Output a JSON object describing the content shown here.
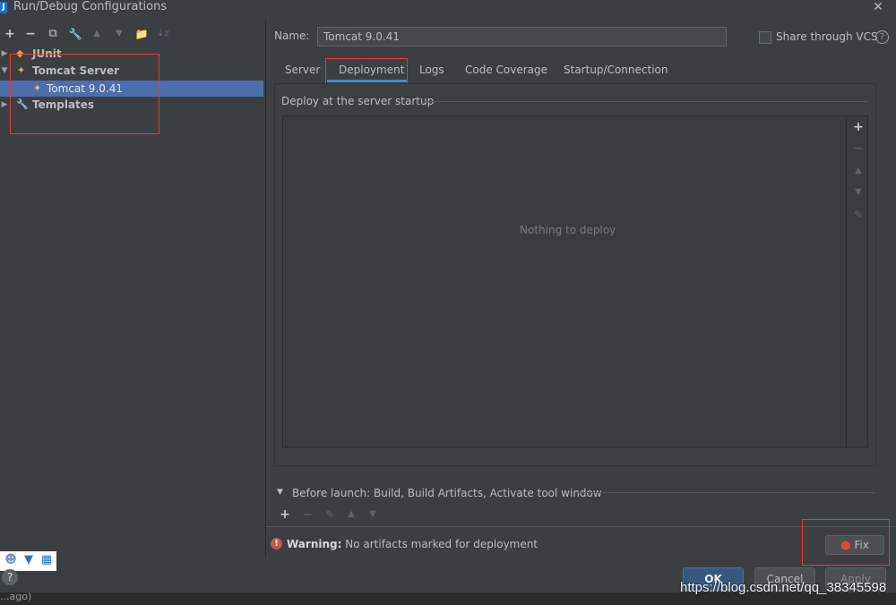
{
  "window": {
    "title": "Run/Debug Configurations",
    "app_icon": "J"
  },
  "toolbar": {
    "add": "+",
    "remove": "−",
    "copy": "⧉",
    "edit": "🔧",
    "up": "▲",
    "down": "▼",
    "folder": "📁",
    "sort": "↓z"
  },
  "tree": {
    "items": [
      {
        "label": "JUnit"
      },
      {
        "label": "Tomcat Server"
      },
      {
        "label": "Tomcat 9.0.41"
      },
      {
        "label": "Templates"
      }
    ]
  },
  "form": {
    "name_label": "Name:",
    "name_value": "Tomcat 9.0.41",
    "share_label": "Share through VCS",
    "help": "?"
  },
  "tabs": [
    {
      "label": "Server"
    },
    {
      "label": "Deployment"
    },
    {
      "label": "Logs"
    },
    {
      "label": "Code Coverage"
    },
    {
      "label": "Startup/Connection"
    }
  ],
  "deployment": {
    "section_title": "Deploy at the server startup",
    "empty_text": "Nothing to deploy"
  },
  "before_launch": {
    "label": "Before launch: Build, Build Artifacts, Activate tool window"
  },
  "warning": {
    "title": "Warning:",
    "message": " No artifacts marked for deployment",
    "fix_label": "Fix"
  },
  "buttons": {
    "ok": "OK",
    "cancel": "Cancel",
    "apply": "Apply"
  },
  "bottom": {
    "partial_text": "...ago)",
    "watermark": "https://blog.csdn.net/qq_38345598"
  },
  "colors": {
    "accent": "#4a88c7",
    "selection": "#4b6eaf",
    "highlight_box": "#e53935",
    "warning": "#c75450"
  }
}
